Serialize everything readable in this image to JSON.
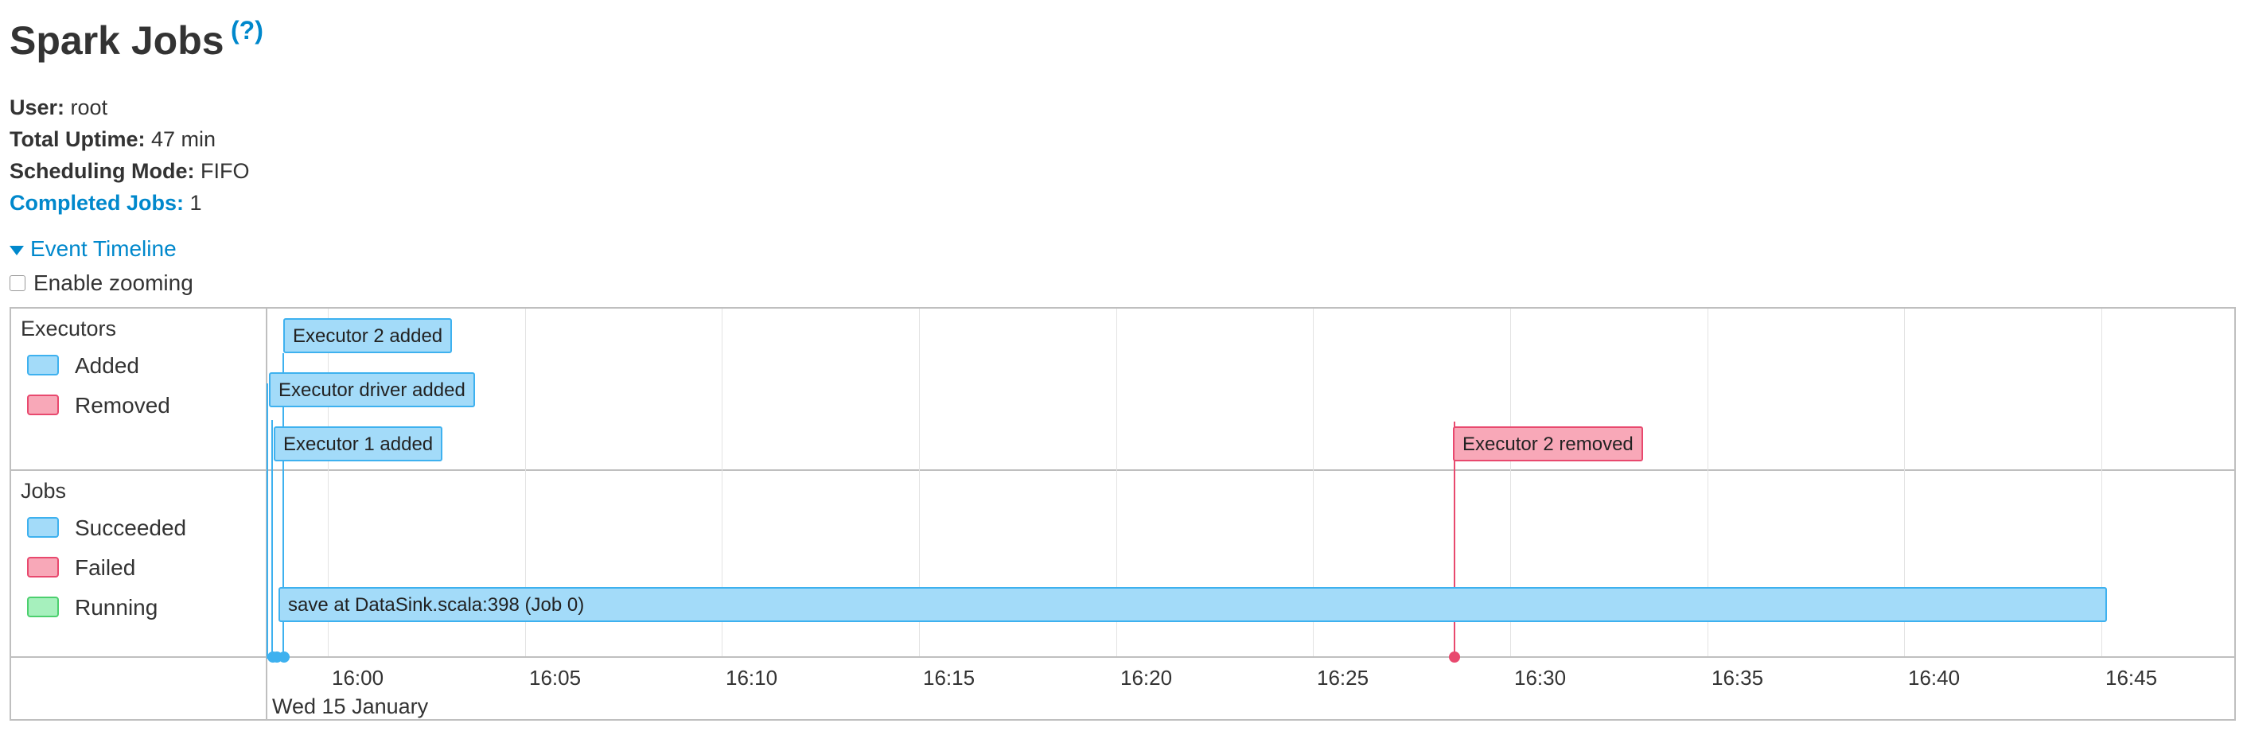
{
  "header": {
    "title": "Spark Jobs",
    "help": "?"
  },
  "info": {
    "user_label": "User:",
    "user_value": "root",
    "uptime_label": "Total Uptime:",
    "uptime_value": "47 min",
    "scheduling_label": "Scheduling Mode:",
    "scheduling_value": "FIFO",
    "completed_label": "Completed Jobs:",
    "completed_value": "1"
  },
  "timeline": {
    "toggle_label": "Event Timeline",
    "zoom_label": "Enable zooming",
    "executors_group": "Executors",
    "executors_legend": [
      {
        "label": "Added",
        "color": "#a3dbf9"
      },
      {
        "label": "Removed",
        "color": "#f8a8b8"
      }
    ],
    "jobs_group": "Jobs",
    "jobs_legend": [
      {
        "label": "Succeeded",
        "color": "#a3dbf9"
      },
      {
        "label": "Failed",
        "color": "#f8a8b8"
      },
      {
        "label": "Running",
        "color": "#a6f0bd"
      }
    ],
    "executor_events": [
      {
        "label": "Executor 2 added",
        "type": "added"
      },
      {
        "label": "Executor driver added",
        "type": "added"
      },
      {
        "label": "Executor 1 added",
        "type": "added"
      },
      {
        "label": "Executor 2 removed",
        "type": "removed"
      }
    ],
    "job": {
      "label": "save at DataSink.scala:398 (Job 0)",
      "status": "succeeded"
    },
    "ticks": [
      "16:00",
      "16:05",
      "16:10",
      "16:15",
      "16:20",
      "16:25",
      "16:30",
      "16:35",
      "16:40",
      "16:45"
    ],
    "date": "Wed 15 January"
  },
  "colors": {
    "accent": "#0088cc",
    "added": "#a3dbf9",
    "removed": "#f8a8b8",
    "running": "#a6f0bd"
  }
}
